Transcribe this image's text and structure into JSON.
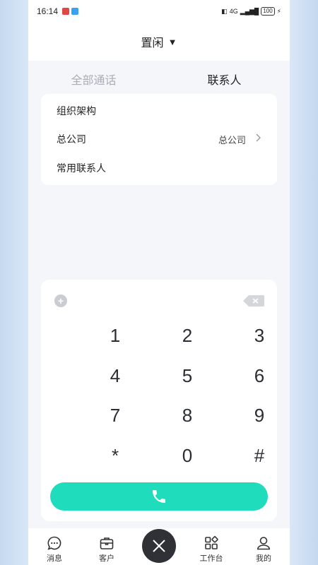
{
  "status_bar": {
    "time": "16:14",
    "network": "4G",
    "battery": "100"
  },
  "header": {
    "status_label": "置闲",
    "caret": "▼"
  },
  "tabs": [
    {
      "label": "全部通话",
      "active": false
    },
    {
      "label": "联系人",
      "active": true
    }
  ],
  "contacts": {
    "org_label": "组织架构",
    "company_label": "总公司",
    "company_value": "总公司",
    "frequent_label": "常用联系人"
  },
  "dialpad": {
    "keys": [
      "1",
      "2",
      "3",
      "4",
      "5",
      "6",
      "7",
      "8",
      "9",
      "*",
      "0",
      "#"
    ]
  },
  "bottom_nav": [
    {
      "label": "消息",
      "icon": "message-icon"
    },
    {
      "label": "客户",
      "icon": "briefcase-icon"
    },
    {
      "label": "",
      "icon": "close-icon"
    },
    {
      "label": "工作台",
      "icon": "grid-icon"
    },
    {
      "label": "我的",
      "icon": "user-icon"
    }
  ],
  "colors": {
    "accent": "#1fdcbd",
    "center_button": "#2f3137"
  }
}
